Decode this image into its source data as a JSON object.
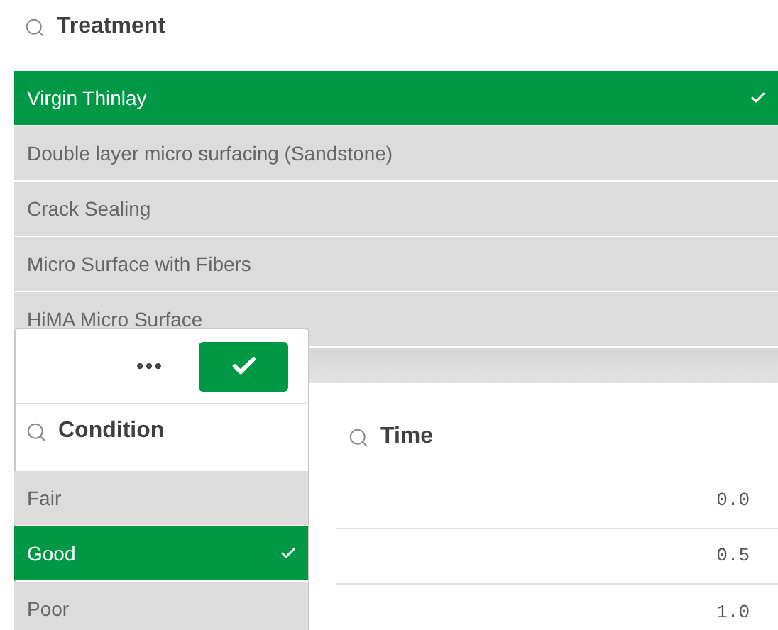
{
  "treatment": {
    "title": "Treatment",
    "items": [
      {
        "label": "Virgin Thinlay",
        "selected": true
      },
      {
        "label": "Double layer micro surfacing (Sandstone)",
        "selected": false
      },
      {
        "label": "Crack Sealing",
        "selected": false
      },
      {
        "label": "Micro Surface with Fibers",
        "selected": false
      },
      {
        "label": "HiMA Micro Surface",
        "selected": false
      }
    ]
  },
  "time": {
    "title": "Time",
    "rows": [
      {
        "value": "0.0"
      },
      {
        "value": "0.5"
      },
      {
        "value": "1.0"
      }
    ]
  },
  "condition": {
    "title": "Condition",
    "items": [
      {
        "label": "Fair",
        "selected": false
      },
      {
        "label": "Good",
        "selected": true
      },
      {
        "label": "Poor",
        "selected": false
      }
    ]
  }
}
